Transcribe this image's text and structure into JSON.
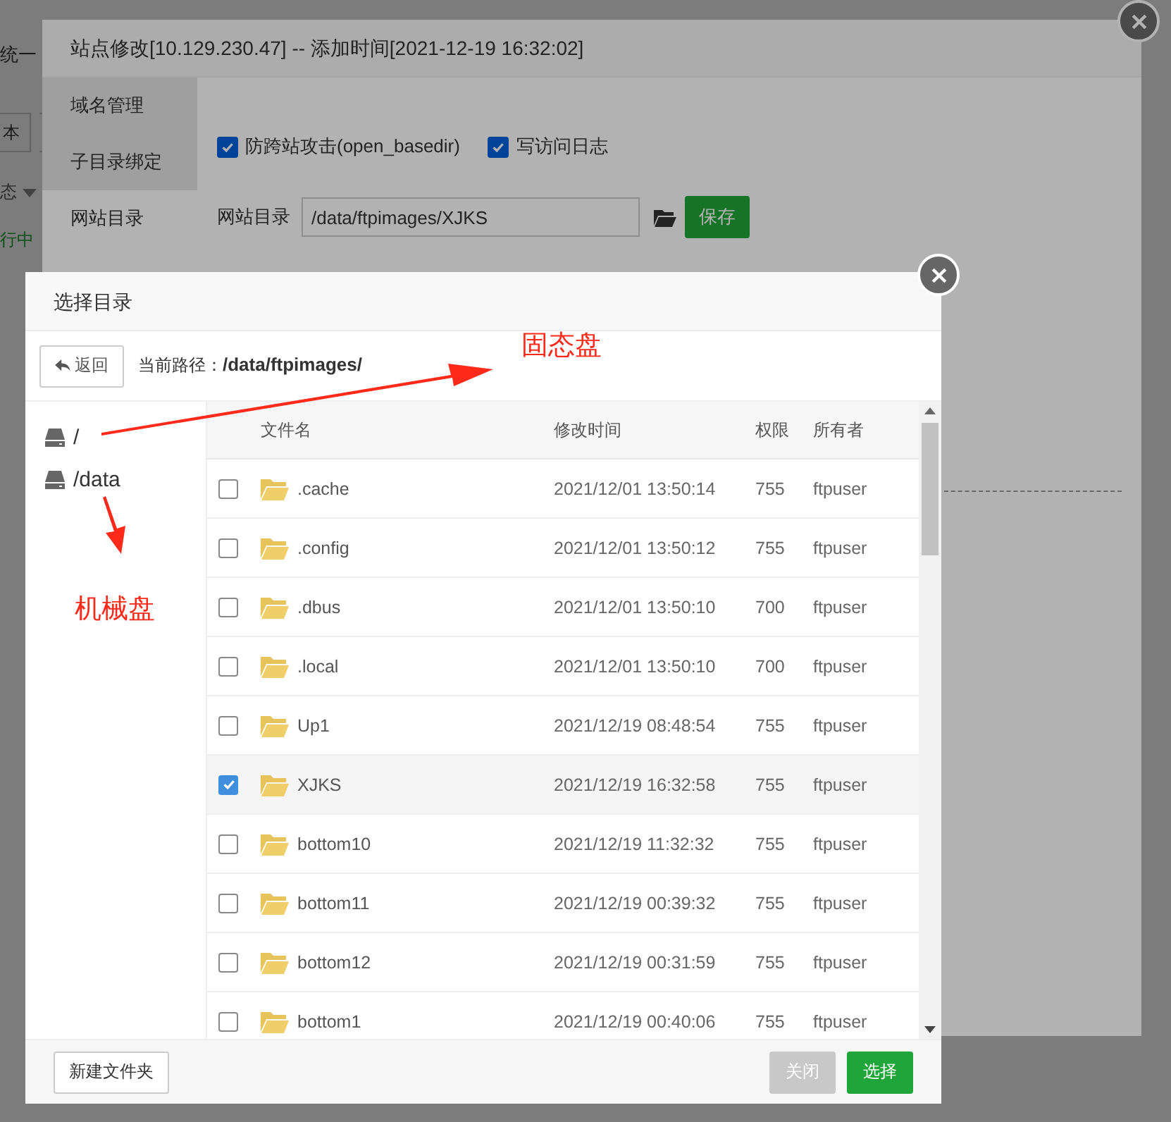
{
  "background_page": {
    "heading_fragment": "统一",
    "button_fragment": "本",
    "filter_fragment": "态",
    "status_fragment": "行中"
  },
  "site_dialog": {
    "title": "站点修改[10.129.230.47] -- 添加时间[2021-12-19 16:32:02]",
    "tabs": [
      {
        "label": "域名管理",
        "selected": false
      },
      {
        "label": "子目录绑定",
        "selected": false
      },
      {
        "label": "网站目录",
        "selected": true
      }
    ],
    "options": [
      {
        "label": "防跨站攻击(open_basedir)",
        "checked": true
      },
      {
        "label": "写访问日志",
        "checked": true
      }
    ],
    "site_dir": {
      "label": "网站目录",
      "value": "/data/ftpimages/XJKS"
    },
    "save_button": "保存"
  },
  "dir_dialog": {
    "title": "选择目录",
    "back_button": "返回",
    "path_label": "当前路径：",
    "path": "/data/ftpimages/",
    "drives": [
      {
        "label": "/"
      },
      {
        "label": "/data"
      }
    ],
    "table": {
      "columns": [
        "文件名",
        "修改时间",
        "权限",
        "所有者"
      ],
      "rows": [
        {
          "name": ".cache",
          "modified": "2021/12/01 13:50:14",
          "permission": "755",
          "owner": "ftpuser",
          "checked": false
        },
        {
          "name": ".config",
          "modified": "2021/12/01 13:50:12",
          "permission": "755",
          "owner": "ftpuser",
          "checked": false
        },
        {
          "name": ".dbus",
          "modified": "2021/12/01 13:50:10",
          "permission": "700",
          "owner": "ftpuser",
          "checked": false
        },
        {
          "name": ".local",
          "modified": "2021/12/01 13:50:10",
          "permission": "700",
          "owner": "ftpuser",
          "checked": false
        },
        {
          "name": "Up1",
          "modified": "2021/12/19 08:48:54",
          "permission": "755",
          "owner": "ftpuser",
          "checked": false
        },
        {
          "name": "XJKS",
          "modified": "2021/12/19 16:32:58",
          "permission": "755",
          "owner": "ftpuser",
          "checked": true
        },
        {
          "name": "bottom10",
          "modified": "2021/12/19 11:32:32",
          "permission": "755",
          "owner": "ftpuser",
          "checked": false
        },
        {
          "name": "bottom11",
          "modified": "2021/12/19 00:39:32",
          "permission": "755",
          "owner": "ftpuser",
          "checked": false
        },
        {
          "name": "bottom12",
          "modified": "2021/12/19 00:31:59",
          "permission": "755",
          "owner": "ftpuser",
          "checked": false
        },
        {
          "name": "bottom1",
          "modified": "2021/12/19 00:40:06",
          "permission": "755",
          "owner": "ftpuser",
          "checked": false
        }
      ]
    },
    "new_folder_button": "新建文件夹",
    "close_button": {
      "label": "关闭",
      "disabled": true
    },
    "select_button": "选择"
  },
  "annotations": [
    {
      "text": "固态盘"
    },
    {
      "text": "机械盘"
    }
  ]
}
